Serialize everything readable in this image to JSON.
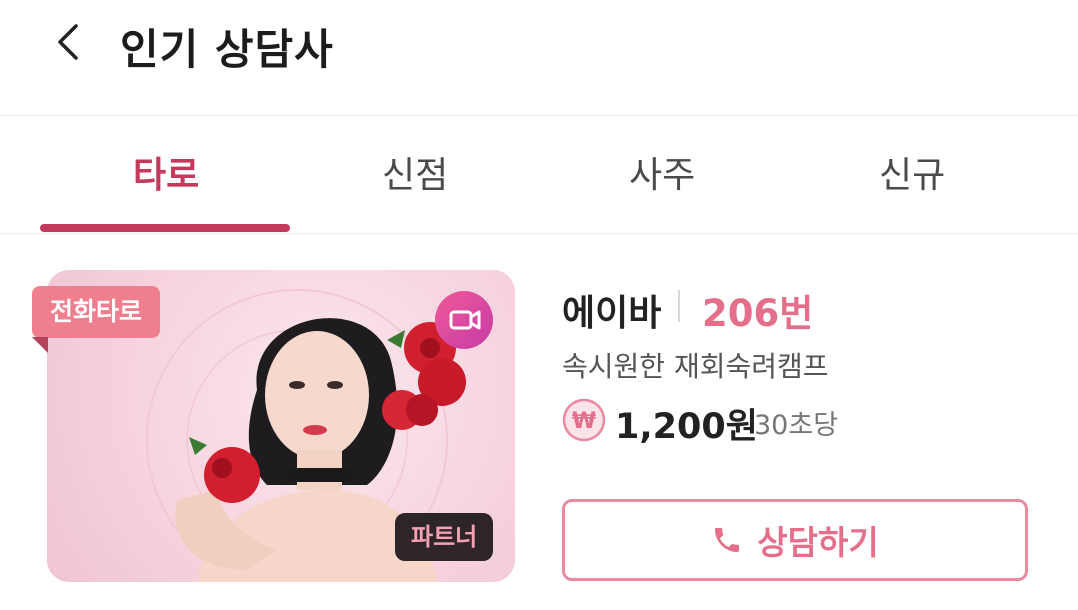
{
  "header": {
    "title": "인기 상담사"
  },
  "tabs": [
    {
      "label": "타로",
      "active": true
    },
    {
      "label": "신점",
      "active": false
    },
    {
      "label": "사주",
      "active": false
    },
    {
      "label": "신규",
      "active": false
    }
  ],
  "card": {
    "category_badge": "전화타로",
    "partner_badge": "파트너",
    "name": "에이바",
    "number": "206번",
    "description": "속시원한 재회숙려캠프",
    "price": "1,200원",
    "price_unit": "30초당",
    "cta_label": "상담하기",
    "icons": [
      "back-icon",
      "video-camera-icon",
      "won-coin-icon",
      "phone-icon"
    ]
  },
  "colors": {
    "accent": "#c43a5c",
    "pink": "#e56f8a",
    "badge": "#ef7f8f",
    "video_gradient": [
      "#f05a9a",
      "#c63aa5"
    ]
  }
}
